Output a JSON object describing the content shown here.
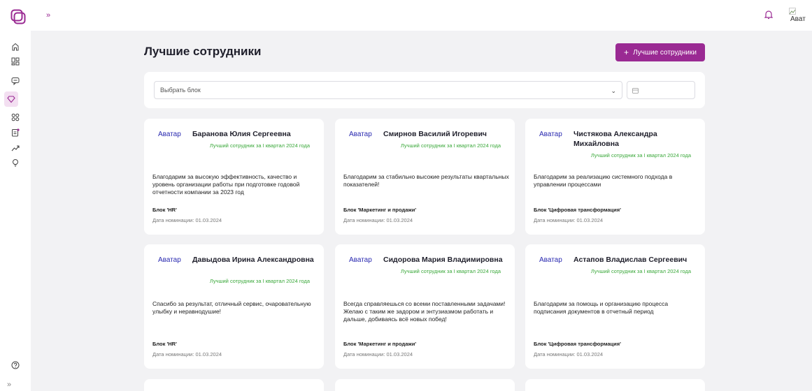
{
  "topbar": {
    "expand_icon": "»",
    "avatar_alt": "Ават",
    "icons": [
      "logo-icon",
      "bell-icon",
      "broken-image-icon"
    ]
  },
  "sidebar": {
    "icons": [
      "home-icon",
      "dashboard-icon",
      "chat-icon",
      "diamond-icon",
      "grid-icon",
      "document-icon",
      "chart-icon",
      "lightbulb-icon",
      "help-icon"
    ],
    "active": "diamond-icon",
    "expand_icon": "»"
  },
  "page": {
    "title": "Лучшие сотрудники"
  },
  "add_button": {
    "label": "Лучшие сотрудники",
    "icon": "+"
  },
  "filter": {
    "placeholder": "Выбрать блок"
  },
  "cards": [
    {
      "avatar": "Аватар",
      "name": "Баранова Юлия Сергеевна",
      "subtitle": "Лучший сотрудник за I квартал 2024 года",
      "text": "Благодарим за высокую эффективность, качество и уровень организации работы при подготовке годовой отчетности компании за 2023 год",
      "block": "Блок 'HR'",
      "date": "Дата номинации: 01.03.2024"
    },
    {
      "avatar": "Аватар",
      "name": "Смирнов Василий Игоревич",
      "subtitle": "Лучший сотрудник за I квартал 2024 года",
      "text": "Благодарим за стабильно высокие результаты квартальных показателей!",
      "block": "Блок 'Маркетинг и продажи'",
      "date": "Дата номинации: 01.03.2024"
    },
    {
      "avatar": "Аватар",
      "name": "Чистякова Александра Михайловна",
      "subtitle": "Лучший сотрудник за I квартал 2024 года",
      "text": "Благодарим за реализацию системного подхода в управлении процессами",
      "block": "Блок 'Цифровая трансформация'",
      "date": "Дата номинации: 01.03.2024"
    },
    {
      "avatar": "Аватар",
      "name": "Давыдова Ирина Александровна",
      "subtitle": "Лучший сотрудник за I квартал 2024 года",
      "text": "Спасибо за результат, отличный сервис, очаровательную улыбку и неравнодушие!",
      "block": "Блок 'HR'",
      "date": "Дата номинации: 01.03.2024"
    },
    {
      "avatar": "Аватар",
      "name": "Сидорова Мария Владимировна",
      "subtitle": "Лучший сотрудник за I квартал 2024 года",
      "text": "Всегда справляешься со всеми поставленными задачами! Желаю с таким же задором и энтузиазмом работать и дальше, добиваясь всё новых побед!",
      "block": "Блок 'Маркетинг и продажи'",
      "date": "Дата номинации: 01.03.2024"
    },
    {
      "avatar": "Аватар",
      "name": "Астапов Владислав Сергеевич",
      "subtitle": "Лучший сотрудник за I квартал 2024 года",
      "text": "Благодарим за помощь и организацию процесса подписания документов в отчетный период",
      "block": "Блок 'Цифровая трансформация'",
      "date": "Дата номинации: 01.03.2024"
    }
  ],
  "colors": {
    "accent": "#9a2a93",
    "subtitle": "#3aa83a",
    "background": "#f2f2f4"
  }
}
